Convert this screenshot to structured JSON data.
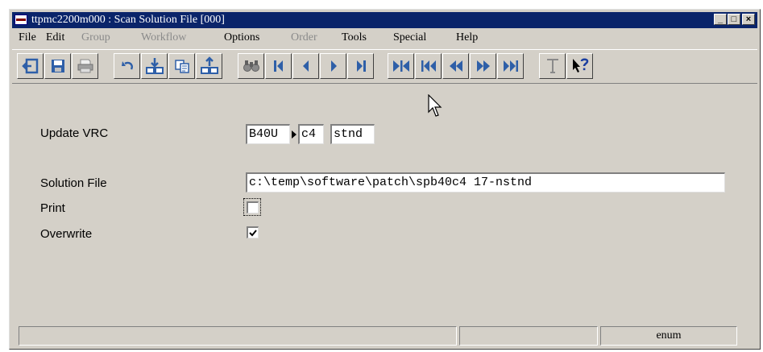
{
  "window": {
    "title": "ttpmc2200m000 : Scan Solution File [000]",
    "minimize": "_",
    "maximize": "□",
    "close": "×"
  },
  "menu": [
    {
      "label": "File",
      "enabled": true
    },
    {
      "label": "Edit",
      "enabled": true
    },
    {
      "label": "Group",
      "enabled": false
    },
    {
      "label": "Workflow",
      "enabled": false
    },
    {
      "label": "Options",
      "enabled": true
    },
    {
      "label": "Order",
      "enabled": false
    },
    {
      "label": "Tools",
      "enabled": true
    },
    {
      "label": "Special",
      "enabled": true
    },
    {
      "label": "Help",
      "enabled": true
    }
  ],
  "toolbar": {
    "icons": [
      "exit-icon",
      "save-icon",
      "print-icon",
      "undo-icon",
      "insert-record-icon",
      "copy-icon",
      "duplicate-record-icon",
      "find-icon",
      "first-record-icon",
      "previous-record-icon",
      "next-record-icon",
      "last-record-icon",
      "first-set-icon",
      "previous-set-icon",
      "rewind-icon",
      "forward-icon",
      "last-set-icon",
      "text-icon",
      "context-help-icon"
    ]
  },
  "form": {
    "update_vrc": {
      "label": "Update VRC",
      "version": "B40U",
      "release": "c4",
      "customization": "stnd"
    },
    "solution_file": {
      "label": "Solution File",
      "value": "c:\\temp\\software\\patch\\spb40c4 17-nstnd"
    },
    "print": {
      "label": "Print",
      "checked": false
    },
    "overwrite": {
      "label": "Overwrite",
      "checked": true
    }
  },
  "status": {
    "panel1": "",
    "panel2": "",
    "panel3": "enum"
  },
  "colors": {
    "title_bar": "#0a246a",
    "face": "#d4d0c8",
    "icon_blue": "#2e5fa8",
    "disabled": "#8a8a8a"
  }
}
